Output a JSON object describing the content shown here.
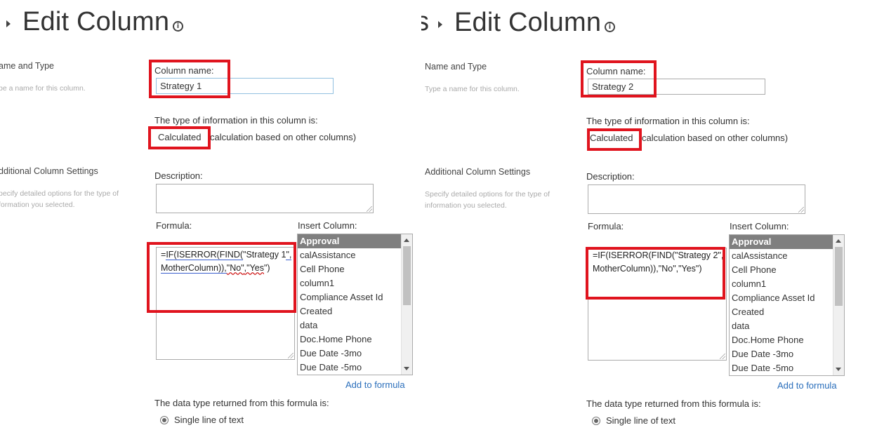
{
  "colors": {
    "highlight": "#e0141e",
    "link": "#2a6ebb",
    "selected_item_bg": "#7f7f7f"
  },
  "icons": {
    "breadcrumb": "breadcrumb-arrow-icon",
    "info": "info-icon"
  },
  "left": {
    "title": "Edit Column",
    "name_section": {
      "title": "ame and Type",
      "desc": "pe a name for this column."
    },
    "settings_section": {
      "title": "dditional Column Settings",
      "desc": "pecify detailed options for the type of\nformation you selected."
    },
    "column_name": {
      "label": "Column name:",
      "value": "Strategy 1"
    },
    "type_info": {
      "label": "The type of information in this column is:",
      "value": "Calculated",
      "rest": "calculation based on other columns)"
    },
    "description": {
      "label": "Description:",
      "value": ""
    },
    "formula": {
      "label": "Formula:",
      "part1": "=",
      "part2": "IF(ISERROR(FIND(",
      "part3": "\"Strategy 1",
      "part4": "\",MotherColumn)),",
      "part5": "\"No\"",
      "part6": ",\"Yes",
      "part7": "\")"
    },
    "insert_column": {
      "label": "Insert Column:",
      "items": [
        "Approval",
        "calAssistance",
        "Cell Phone",
        "column1",
        "Compliance Asset Id",
        "Created",
        "data",
        "Doc.Home Phone",
        "Due Date -3mo",
        "Due Date -5mo"
      ]
    },
    "add_to_formula": "Add to formula",
    "return_type": {
      "label": "The data type returned from this formula is:",
      "option": "Single line of text"
    }
  },
  "right": {
    "prefix": "s",
    "title": "Edit Column",
    "name_section": {
      "title": "Name and Type",
      "desc": "Type a name for this column."
    },
    "settings_section": {
      "title": "Additional Column Settings",
      "desc": "Specify detailed options for the type of\ninformation you selected."
    },
    "column_name": {
      "label": "Column name:",
      "value": "Strategy 2"
    },
    "type_info": {
      "label": "The type of information in this column is:",
      "value": "Calculated",
      "rest": "calculation based on other columns)"
    },
    "description": {
      "label": "Description:",
      "value": ""
    },
    "formula": {
      "label": "Formula:",
      "text": "=IF(ISERROR(FIND(\"Strategy 2\",MotherColumn)),\"No\",\"Yes\")"
    },
    "insert_column": {
      "label": "Insert Column:",
      "items": [
        "Approval",
        "calAssistance",
        "Cell Phone",
        "column1",
        "Compliance Asset Id",
        "Created",
        "data",
        "Doc.Home Phone",
        "Due Date -3mo",
        "Due Date -5mo"
      ]
    },
    "add_to_formula": "Add to formula",
    "return_type": {
      "label": "The data type returned from this formula is:",
      "option": "Single line of text"
    }
  }
}
